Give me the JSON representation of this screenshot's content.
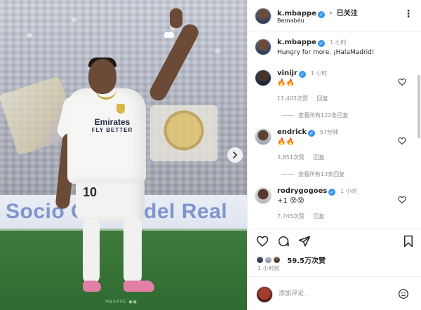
{
  "post": {
    "banner_text": "Socio Oficial del Real",
    "jersey_sponsor": "Emirates",
    "jersey_sponsor_sub": "FLY BETTER",
    "jersey_number": "10",
    "next_icon": "chevron-right-icon",
    "watermark": "MBAPPE ●●"
  },
  "header": {
    "username": "k.mbappe",
    "verified_icon": "verified-badge-icon",
    "separator": "•",
    "follow_state": "已关注",
    "location": "Bernabéu",
    "more_icon": "more-options-icon",
    "more_label": "⋮"
  },
  "caption": {
    "username": "k.mbappe",
    "time": "1 小时",
    "text": "Hungry for more. ¡HalaMadrid!"
  },
  "comments": [
    {
      "username": "vinijr",
      "time": "1 小时",
      "text": "🔥🔥",
      "likes": "11,403次赞",
      "reply": "回复",
      "view_replies": "查看所有122条回复"
    },
    {
      "username": "endrick",
      "time": "57分钟",
      "text": "🔥🔥",
      "likes": "3,851次赞",
      "reply": "回复",
      "view_replies": "查看所有13条回复"
    },
    {
      "username": "rodrygogoes",
      "time": "1 小时",
      "text": "+1 😵😵",
      "likes": "7,745次赞",
      "reply": "回复"
    }
  ],
  "actions": {
    "like_icon": "heart-icon",
    "comment_icon": "comment-icon",
    "share_icon": "send-icon",
    "save_icon": "bookmark-icon"
  },
  "stats": {
    "likes": "59.5万次赞",
    "posted": "1 小时前"
  },
  "composer": {
    "placeholder": "添加评论...",
    "emoji_icon": "emoji-icon"
  },
  "colors": {
    "verified": "#3897f0",
    "muted_text": "#8e8e8e",
    "primary_text": "#262626"
  }
}
